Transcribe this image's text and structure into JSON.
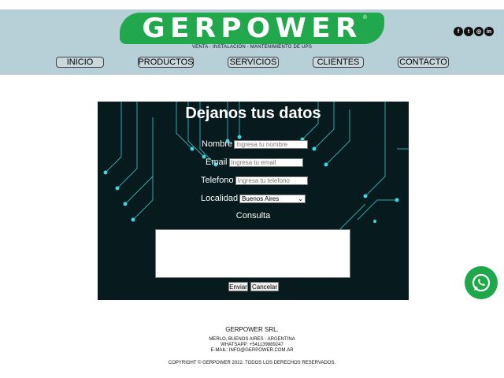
{
  "header": {
    "logo": "GERPOWER",
    "tagline": "VENTA - INSTALACIÓN - MANTENIMIENTO DE UPS",
    "social": [
      {
        "icon": "facebook-icon",
        "glyph": "f"
      },
      {
        "icon": "twitter-icon",
        "glyph": "t"
      },
      {
        "icon": "instagram-icon",
        "glyph": "◎"
      },
      {
        "icon": "linkedin-icon",
        "glyph": "in"
      }
    ]
  },
  "nav": [
    "INICIO",
    "PRODUCTOS",
    "SERVICIOS",
    "CLIENTES",
    "CONTACTO"
  ],
  "form": {
    "title": "Dejanos tus datos",
    "nombre_label": "Nombre",
    "nombre_placeholder": "Ingresa tu nombre",
    "email_label": "Email",
    "email_placeholder": "Ingresa tu email",
    "telefono_label": "Telefono",
    "telefono_placeholder": "Ingresa tu telefono",
    "localidad_label": "Localidad",
    "localidad_value": "Buenos Aires",
    "consulta_label": "Consulta",
    "enviar": "Enviar",
    "cancelar": "Cancelar"
  },
  "footer": {
    "company": "GERPOWER SRL.",
    "address": "MERLO, BUENOS AIRES - ARGENTINA",
    "whatsapp": "WHATSAPP: +541139889247",
    "email": "E-MAIL:  INFO@GERPOWER.COM.AR",
    "copyright": "COPYRIGHT © GERPOWER 2022. TODOS LOS DERECHOS RESERVADOS."
  },
  "colors": {
    "header_bg": "#b7cfd7",
    "logo_green": "#21a84c",
    "form_bg": "#071a1d",
    "circuit": "#3fd6e0"
  }
}
